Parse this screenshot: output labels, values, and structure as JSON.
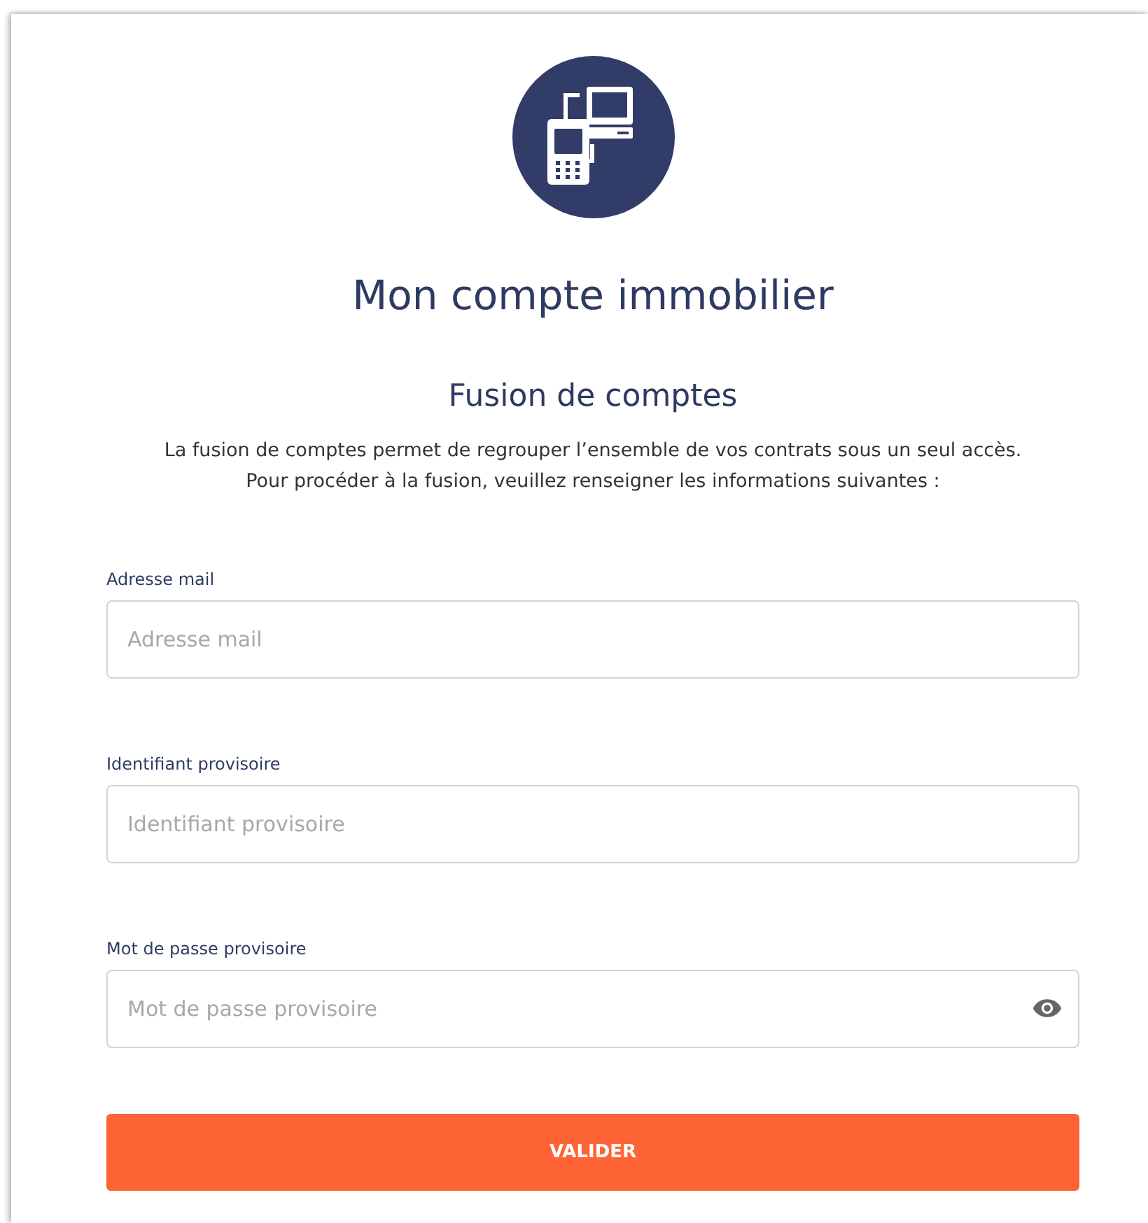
{
  "title": "Mon compte immobilier",
  "subtitle": "Fusion de comptes",
  "description": [
    "La fusion de comptes permet de regrouper l’ensemble de vos contrats sous un seul accès.",
    "Pour procéder à la fusion, veuillez renseigner les informations suivantes :"
  ],
  "fields": [
    {
      "kind": "text",
      "label": "Adresse mail",
      "placeholder": "Adresse mail"
    },
    {
      "kind": "text",
      "label": "Identifiant provisoire",
      "placeholder": "Identifiant provisoire"
    },
    {
      "kind": "password",
      "label": "Mot de passe provisoire",
      "placeholder": "Mot de passe provisoire"
    }
  ],
  "submit": "VALIDER"
}
